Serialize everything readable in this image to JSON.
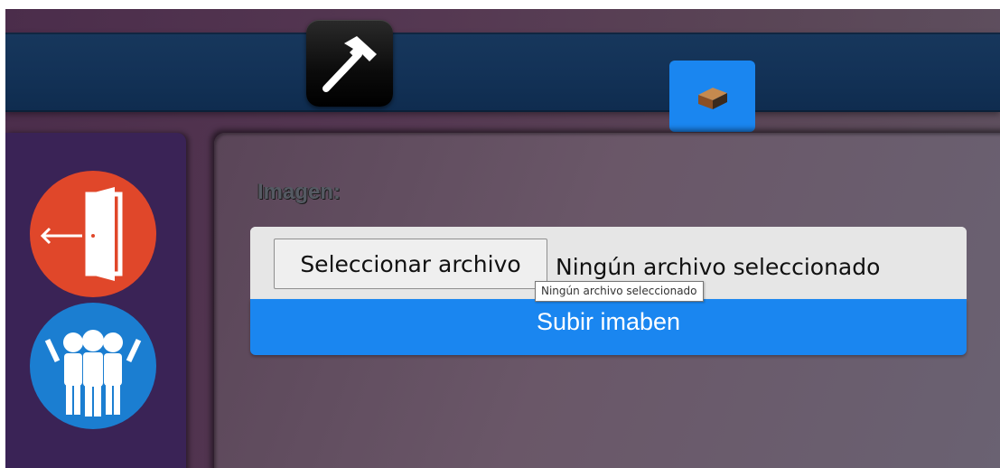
{
  "toolbar": {
    "tools": [
      {
        "icon": "hammer-icon",
        "background": "#000000"
      },
      {
        "icon": "brick-icon",
        "background": "#1a86f0"
      }
    ]
  },
  "sidebar": {
    "items": [
      {
        "icon": "exit-door-icon",
        "color": "#e0472a"
      },
      {
        "icon": "group-people-icon",
        "color": "#1b7ed1"
      }
    ]
  },
  "form": {
    "image_label": "Imagen:",
    "file_button_label": "Seleccionar archivo",
    "file_status": "Ningún archivo seleccionado",
    "upload_button_label": "Subir imaben",
    "tooltip": "Ningún archivo seleccionado"
  },
  "colors": {
    "accent": "#1a86f0",
    "topbar": "#133257",
    "sidebar": "#3a2356"
  }
}
